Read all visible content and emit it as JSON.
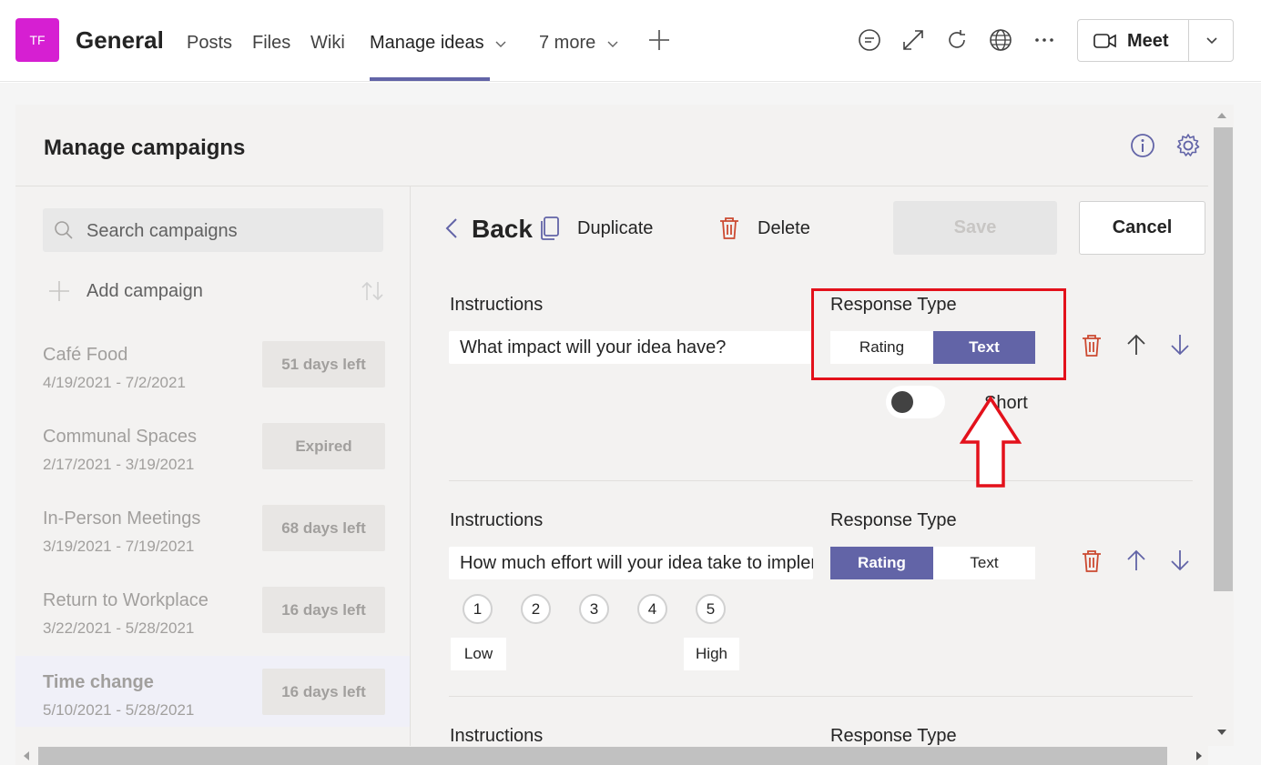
{
  "header": {
    "avatar_initials": "TF",
    "channel_name": "General",
    "tabs": [
      {
        "label": "Posts"
      },
      {
        "label": "Files"
      },
      {
        "label": "Wiki"
      },
      {
        "label": "Manage ideas"
      },
      {
        "label": "7 more"
      }
    ],
    "meet_label": "Meet",
    "accent_color": "#6264a7",
    "avatar_color": "#d61fd2"
  },
  "panel": {
    "title": "Manage campaigns"
  },
  "sidebar": {
    "search_placeholder": "Search campaigns",
    "add_label": "Add campaign",
    "campaigns": [
      {
        "title": "Café Food",
        "dates": "4/19/2021 - 7/2/2021",
        "status": "51 days left"
      },
      {
        "title": "Communal Spaces",
        "dates": "2/17/2021 - 3/19/2021",
        "status": "Expired"
      },
      {
        "title": "In-Person Meetings",
        "dates": "3/19/2021 - 7/19/2021",
        "status": "68 days left"
      },
      {
        "title": "Return to Workplace",
        "dates": "3/22/2021 - 5/28/2021",
        "status": "16 days left"
      },
      {
        "title": "Time change",
        "dates": "5/10/2021 - 5/28/2021",
        "status": "16 days left",
        "selected": true
      }
    ]
  },
  "editor": {
    "back_label": "Back",
    "duplicate_label": "Duplicate",
    "delete_label": "Delete",
    "save_label": "Save",
    "cancel_label": "Cancel",
    "questions": [
      {
        "instructions_label": "Instructions",
        "instructions_value": "What impact will your idea have?",
        "response_type_label": "Response Type",
        "options": [
          "Rating",
          "Text"
        ],
        "selected": "Text",
        "toggle_label": "Short"
      },
      {
        "instructions_label": "Instructions",
        "instructions_value": "How much effort will your idea take to implement?",
        "response_type_label": "Response Type",
        "options": [
          "Rating",
          "Text"
        ],
        "selected": "Rating",
        "rating_values": [
          "1",
          "2",
          "3",
          "4",
          "5"
        ],
        "low_label": "Low",
        "high_label": "High"
      },
      {
        "instructions_label": "Instructions",
        "response_type_label": "Response Type"
      }
    ]
  },
  "annotation": {
    "highlight_color": "#e3111b"
  }
}
